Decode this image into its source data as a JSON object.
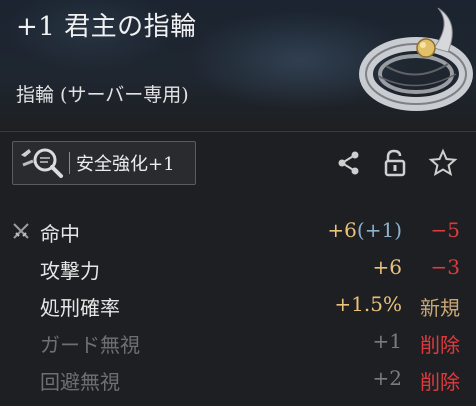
{
  "item": {
    "title": "+1 君主の指輪",
    "type_label": "指輪 (サーバー専用)"
  },
  "actions": {
    "enhance_label": "安全強化+1",
    "share_icon": "share-icon",
    "lock_icon": "unlock-icon",
    "favorite_icon": "star-icon"
  },
  "stats": [
    {
      "name": "命中",
      "value": "+6",
      "value_extra": "(+1)",
      "diff": "−5",
      "diff_kind": "decrease"
    },
    {
      "name": "攻撃力",
      "value": "+6",
      "value_extra": "",
      "diff": "−3",
      "diff_kind": "decrease"
    },
    {
      "name": "処刑確率",
      "value": "+1.5%",
      "value_extra": "",
      "diff": "新規",
      "diff_kind": "new"
    },
    {
      "name": "ガード無視",
      "value": "+1",
      "value_extra": "",
      "diff": "削除",
      "diff_kind": "removed"
    },
    {
      "name": "回避無視",
      "value": "+2",
      "value_extra": "",
      "diff": "削除",
      "diff_kind": "removed"
    }
  ],
  "colors": {
    "value_gold": "#e9c37c",
    "extra_blue": "#8fb3cf",
    "decrease_red": "#e03a3e",
    "new_tan": "#c9a777",
    "dim_text": "#6e6f73"
  }
}
